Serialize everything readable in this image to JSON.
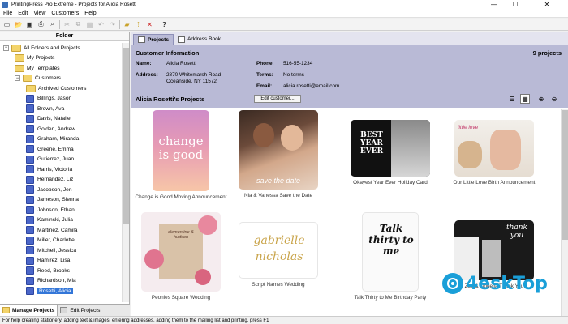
{
  "window": {
    "title": "PrintingPress Pro Extreme - Projects for Alicia Rosetti",
    "minimize": "—",
    "maximize": "☐",
    "close": "✕"
  },
  "menu": [
    "File",
    "Edit",
    "View",
    "Customers",
    "Help"
  ],
  "toolbar_icons": [
    "new-icon",
    "open-icon",
    "save-icon",
    "print-icon",
    "print-preview-icon",
    "cut-icon",
    "copy-icon",
    "paste-icon",
    "undo-icon",
    "redo-icon",
    "new-folder-icon",
    "folder-up-icon",
    "delete-icon",
    "help-icon"
  ],
  "left": {
    "header": "Folder",
    "tree": [
      {
        "label": "All Folders and Projects",
        "indent": 0,
        "icon": "folder",
        "expander": "−"
      },
      {
        "label": "My Projects",
        "indent": 1,
        "icon": "folder"
      },
      {
        "label": "My Templates",
        "indent": 1,
        "icon": "folder"
      },
      {
        "label": "Customers",
        "indent": 1,
        "icon": "folder",
        "expander": "−"
      },
      {
        "label": "Archived Customers",
        "indent": 2,
        "icon": "folder"
      },
      {
        "label": "Billings, Jason",
        "indent": 2,
        "icon": "customer"
      },
      {
        "label": "Brown, Ava",
        "indent": 2,
        "icon": "customer"
      },
      {
        "label": "Davis, Natalie",
        "indent": 2,
        "icon": "customer"
      },
      {
        "label": "Golden, Andrew",
        "indent": 2,
        "icon": "customer"
      },
      {
        "label": "Graham, Miranda",
        "indent": 2,
        "icon": "customer"
      },
      {
        "label": "Greene, Emma",
        "indent": 2,
        "icon": "customer"
      },
      {
        "label": "Gutierrez, Juan",
        "indent": 2,
        "icon": "customer"
      },
      {
        "label": "Harris, Victoria",
        "indent": 2,
        "icon": "customer"
      },
      {
        "label": "Hernandez, Liz",
        "indent": 2,
        "icon": "customer"
      },
      {
        "label": "Jacobson, Jen",
        "indent": 2,
        "icon": "customer"
      },
      {
        "label": "Jameson, Sienna",
        "indent": 2,
        "icon": "customer"
      },
      {
        "label": "Johnson, Ethan",
        "indent": 2,
        "icon": "customer"
      },
      {
        "label": "Kaminski, Julia",
        "indent": 2,
        "icon": "customer"
      },
      {
        "label": "Martinez, Camila",
        "indent": 2,
        "icon": "customer"
      },
      {
        "label": "Miller, Charlotte",
        "indent": 2,
        "icon": "customer"
      },
      {
        "label": "Mitchell, Jessica",
        "indent": 2,
        "icon": "customer"
      },
      {
        "label": "Ramirez, Lisa",
        "indent": 2,
        "icon": "customer"
      },
      {
        "label": "Reed, Brooks",
        "indent": 2,
        "icon": "customer"
      },
      {
        "label": "Richardson, Mia",
        "indent": 2,
        "icon": "customer"
      },
      {
        "label": "Rosetti, Alicia",
        "indent": 2,
        "icon": "customer",
        "selected": true
      }
    ],
    "tabs": {
      "manage": "Manage Projects",
      "edit": "Edit Projects"
    }
  },
  "right": {
    "tabs": {
      "projects": "Projects",
      "address_book": "Address Book"
    },
    "customer": {
      "title": "Customer Information",
      "count": "9 projects",
      "name_label": "Name:",
      "name": "Alicia Rosetti",
      "address_label": "Address:",
      "address1": "2870 Whitemarsh Road",
      "address2": "Oceanside, NY 11572",
      "phone_label": "Phone:",
      "phone": "516-55-1234",
      "terms_label": "Terms:",
      "terms": "No terms",
      "email_label": "Email:",
      "email": "alicia.rosetti@email.com"
    },
    "projects_title": "Alicia Rosetti's Projects",
    "edit_button": "Edit customer...",
    "view_icons": [
      "details-view-icon",
      "thumbnail-view-icon",
      "zoom-in-icon",
      "zoom-out-icon"
    ],
    "projects": [
      {
        "caption": "Change is Good Moving Announcement",
        "art": "change is good"
      },
      {
        "caption": "Nia & Vanessa Save the Date",
        "art": "save the date"
      },
      {
        "caption": "Okayest Year Ever Holiday Card",
        "art": "BEST YEAR EVER"
      },
      {
        "caption": "Our Little Love Birth Announcement",
        "art": "little love"
      },
      {
        "caption": "Peonies Square Wedding",
        "art": "clementine & hudson"
      },
      {
        "caption": "Script Names Wedding",
        "art": "gabrielle nicholas"
      },
      {
        "caption": "Talk Thirty to Me Birthday Party",
        "art": "Talk thirty to me"
      },
      {
        "caption": "Zoe & Ophelia Thank You",
        "art": "thank you"
      }
    ]
  },
  "statusbar": "For help creating stationery, adding text & images, entering addresses, adding them to the mailing list and printing, press F1",
  "watermark": "4eskTop",
  "colors": {
    "info_panel": "#b9bad6",
    "selection": "#3376d8",
    "accent": "#1a9fd8"
  }
}
